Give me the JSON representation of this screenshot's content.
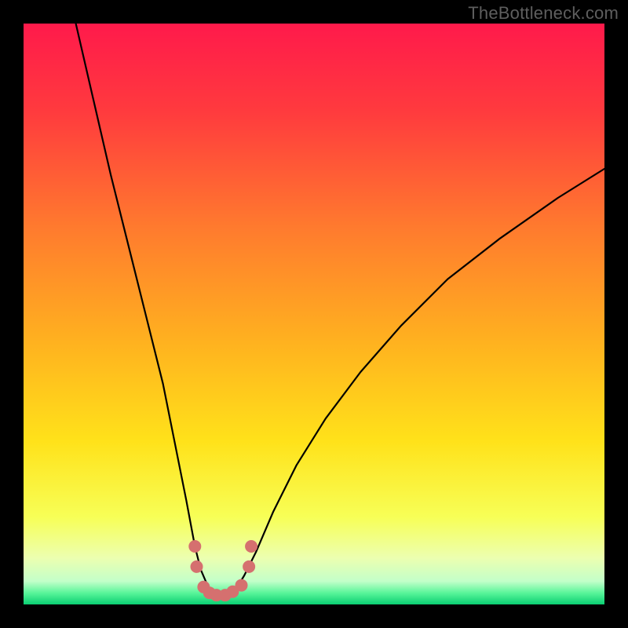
{
  "watermark": "TheBottleneck.com",
  "chart_data": {
    "type": "line",
    "title": "",
    "xlabel": "",
    "ylabel": "",
    "xlim": [
      0,
      100
    ],
    "ylim": [
      0,
      100
    ],
    "grid": false,
    "series": [
      {
        "name": "bottleneck-curve",
        "x": [
          9,
          12,
          15,
          18,
          21,
          24,
          26,
          28,
          29.5,
          30.5,
          32,
          33.5,
          35,
          36.5,
          38,
          40,
          43,
          47,
          52,
          58,
          65,
          73,
          82,
          92,
          100
        ],
        "y": [
          100,
          87,
          74,
          62,
          50,
          38,
          28,
          18,
          10,
          6,
          2.5,
          1.5,
          1.5,
          2.5,
          5,
          9,
          16,
          24,
          32,
          40,
          48,
          56,
          63,
          70,
          75
        ]
      }
    ],
    "markers": {
      "name": "marker-points",
      "color": "#d5706f",
      "radius_px": 8,
      "points": [
        {
          "x": 29.5,
          "y": 10
        },
        {
          "x": 29.8,
          "y": 6.5
        },
        {
          "x": 31.0,
          "y": 3.0
        },
        {
          "x": 32.0,
          "y": 2.0
        },
        {
          "x": 33.2,
          "y": 1.6
        },
        {
          "x": 34.7,
          "y": 1.6
        },
        {
          "x": 36.0,
          "y": 2.2
        },
        {
          "x": 37.5,
          "y": 3.3
        },
        {
          "x": 38.8,
          "y": 6.5
        },
        {
          "x": 39.2,
          "y": 10
        }
      ]
    },
    "gradient_stops": [
      {
        "offset": 0,
        "color": "#ff1a4b"
      },
      {
        "offset": 15,
        "color": "#ff3a3e"
      },
      {
        "offset": 35,
        "color": "#ff7a2e"
      },
      {
        "offset": 55,
        "color": "#ffb21f"
      },
      {
        "offset": 72,
        "color": "#ffe21a"
      },
      {
        "offset": 85,
        "color": "#f7ff57"
      },
      {
        "offset": 92,
        "color": "#ecffb0"
      },
      {
        "offset": 96,
        "color": "#c3ffc9"
      },
      {
        "offset": 98,
        "color": "#5af59a"
      },
      {
        "offset": 100,
        "color": "#0acf72"
      }
    ]
  }
}
